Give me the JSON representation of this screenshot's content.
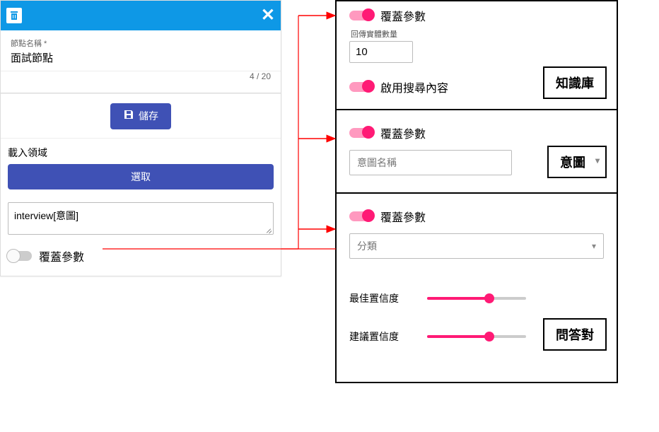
{
  "left": {
    "node_name_label": "節點名稱 *",
    "node_name_value": "面試節點",
    "counter": "4 / 20",
    "save_label": "儲存",
    "load_domain_label": "載入領域",
    "select_label": "選取",
    "domain_text": "interview[意圖]",
    "override_label": "覆蓋參數"
  },
  "kb": {
    "override_label": "覆蓋參數",
    "return_entity_label": "回傳實體數量",
    "return_entity_value": "10",
    "enable_search_label": "啟用搜尋內容",
    "badge": "知識庫"
  },
  "intent": {
    "override_label": "覆蓋參數",
    "select_placeholder": "意圖名稱",
    "badge": "意圖"
  },
  "qa": {
    "override_label": "覆蓋參數",
    "select_placeholder": "分類",
    "best_conf_label": "最佳置信度",
    "suggest_conf_label": "建議置信度",
    "badge": "問答對"
  }
}
